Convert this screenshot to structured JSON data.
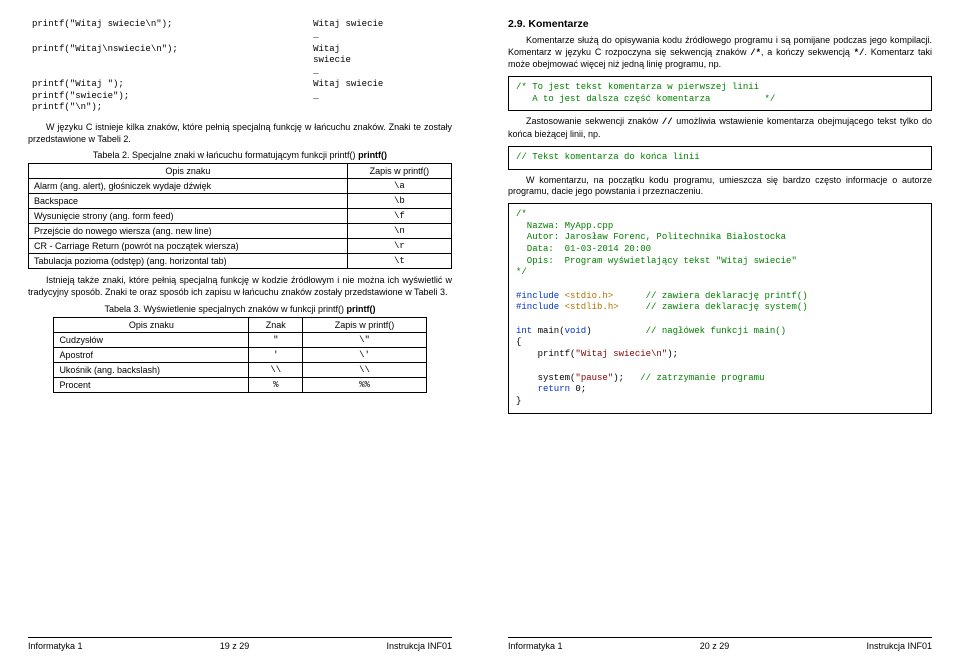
{
  "left": {
    "codeout_rows": [
      {
        "code": "printf(\"Witaj swiecie\\n\");",
        "out": "Witaj swiecie\n_"
      },
      {
        "code": "printf(\"Witaj\\nswiecie\\n\");",
        "out": "Witaj\nswiecie\n_"
      },
      {
        "code": "printf(\"Witaj \");\nprintf(\"swiecie\");\nprintf(\"\\n\");",
        "out": "Witaj swiecie\n_"
      }
    ],
    "para1": "W języku C istnieje kilka znaków, które pełnią specjalną funkcję w łańcuchu znaków. Znaki te zostały przedstawione w Tabeli 2.",
    "caption1": "Tabela 2. Specjalne znaki w łańcuchu formatującym funkcji printf()",
    "t1head": {
      "c1": "Opis znaku",
      "c2": "Zapis w printf()"
    },
    "t1": [
      {
        "c1": "Alarm (ang. alert), głośniczek wydaje dźwięk",
        "c2": "\\a"
      },
      {
        "c1": "Backspace",
        "c2": "\\b"
      },
      {
        "c1": "Wysunięcie strony (ang. form feed)",
        "c2": "\\f"
      },
      {
        "c1": "Przejście do nowego wiersza (ang. new line)",
        "c2": "\\n"
      },
      {
        "c1": "CR - Carriage Return (powrót na początek wiersza)",
        "c2": "\\r"
      },
      {
        "c1": "Tabulacja pozioma (odstęp) (ang. horizontal tab)",
        "c2": "\\t"
      }
    ],
    "para2": "Istnieją także znaki, które pełnią specjalną funkcję w kodzie źródłowym i nie można ich wyświetlić w tradycyjny sposób. Znaki te oraz sposób ich zapisu w łańcuchu znaków zostały przedstawione w Tabeli 3.",
    "caption2": "Tabela 3. Wyświetlenie specjalnych znaków w funkcji printf()",
    "t2head": {
      "c1": "Opis znaku",
      "c2": "Znak",
      "c3": "Zapis w printf()"
    },
    "t2": [
      {
        "c1": "Cudzysłów",
        "c2": "\"",
        "c3": "\\\""
      },
      {
        "c1": "Apostrof",
        "c2": "'",
        "c3": "\\'"
      },
      {
        "c1": "Ukośnik (ang. backslash)",
        "c2": "\\\\",
        "c3": "\\\\"
      },
      {
        "c1": "Procent",
        "c2": "%",
        "c3": "%%"
      }
    ],
    "footer": {
      "l": "Informatyka 1",
      "c": "19 z 29",
      "r": "Instrukcja INF01"
    }
  },
  "right": {
    "sect": "2.9. Komentarze",
    "para1a": "Komentarze służą do opisywania kodu źródłowego programu i są pomijane podczas jego kompilacji. Komentarz w języku C rozpoczyna się sekwencją znaków ",
    "para1b": ", a kończy sekwencją ",
    "para1c": ". Komentarz taki może obejmować więcej niż jedną linię programu, np.",
    "cbox1a": "/* To jest tekst komentarza w pierwszej linii",
    "cbox1b": "   A to jest dalsza część komentarza          */",
    "para2a": "Zastosowanie sekwencji znaków ",
    "para2b": " umożliwia wstawienie komentarza obejmującego tekst tylko do końca bieżącej linii, np.",
    "cbox2": "// Tekst komentarza do końca linii",
    "para3": "W komentarzu, na początku kodu programu, umieszcza się bardzo często informacje o autorze programu, dacie jego powstania i przeznaczeniu.",
    "cbox3": {
      "l1": "/*",
      "l2": "  Nazwa: MyApp.cpp",
      "l3": "  Autor: Jarosław Forenc, Politechnika Białostocka",
      "l4": "  Data:  01-03-2014 20:00",
      "l5": "  Opis:  Program wyświetlający tekst \"Witaj swiecie\"",
      "l6": "*/",
      "i1": "#include ",
      "i1s": "<stdio.h>",
      "i1c": "      // zawiera deklarację printf()",
      "i2": "#include ",
      "i2s": "<stdlib.h>",
      "i2c": "     // zawiera deklarację system()",
      "mh": "int main(void)          ",
      "mhc": "// nagłówek funkcji main()",
      "ob": "{",
      "p1": "    printf(",
      "p1s": "\"Witaj swiecie\\n\"",
      "p1e": ");",
      "s1": "    system(",
      "s1s": "\"pause\"",
      "s1e": ");   ",
      "s1c": "// zatrzymanie programu",
      "r": "    return 0;",
      "cb": "}"
    },
    "footer": {
      "l": "Informatyka 1",
      "c": "20 z 29",
      "r": "Instrukcja INF01"
    }
  }
}
